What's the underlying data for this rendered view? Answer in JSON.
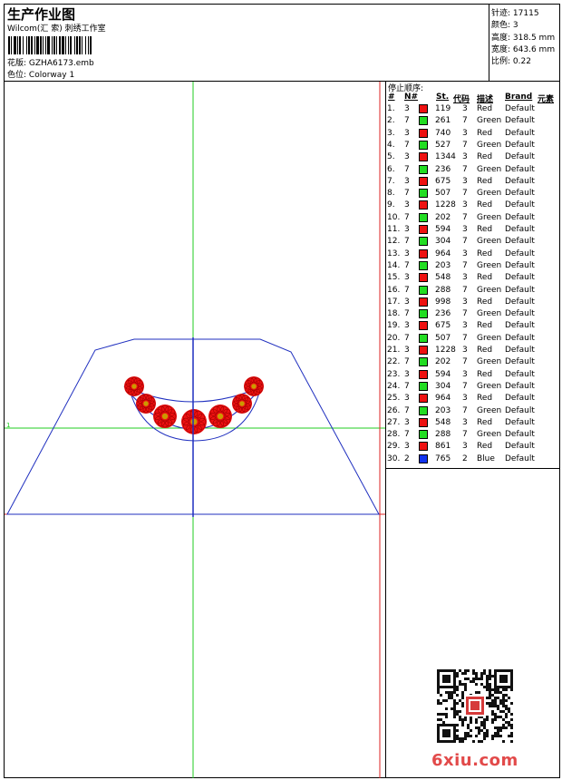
{
  "header": {
    "title": "生产作业图",
    "subtitle": "Wilcom(汇 索) 刺绣工作室",
    "design_label": "花版:",
    "design_value": "GZHA6173.emb",
    "colorway_label": "色位:",
    "colorway_value": "Colorway 1"
  },
  "stats": {
    "stitches_label": "针迹:",
    "stitches_value": "17115",
    "colors_label": "颜色:",
    "colors_value": "3",
    "height_label": "高度:",
    "height_value": "318.5 mm",
    "width_label": "宽度:",
    "width_value": "643.6 mm",
    "scale_label": "比例:",
    "scale_value": "0.22"
  },
  "stop_sequence": {
    "title": "停止顺序:",
    "headers": [
      "#",
      "N#",
      "St.",
      "代码",
      "描述",
      "Brand",
      "元素"
    ],
    "rows": [
      {
        "idx": "1.",
        "n": "3",
        "color": "#ee1111",
        "st": "119",
        "code": "3",
        "desc": "Red",
        "brand": "Default"
      },
      {
        "idx": "2.",
        "n": "7",
        "color": "#22dd22",
        "st": "261",
        "code": "7",
        "desc": "Green",
        "brand": "Default"
      },
      {
        "idx": "3.",
        "n": "3",
        "color": "#ee1111",
        "st": "740",
        "code": "3",
        "desc": "Red",
        "brand": "Default"
      },
      {
        "idx": "4.",
        "n": "7",
        "color": "#22dd22",
        "st": "527",
        "code": "7",
        "desc": "Green",
        "brand": "Default"
      },
      {
        "idx": "5.",
        "n": "3",
        "color": "#ee1111",
        "st": "1344",
        "code": "3",
        "desc": "Red",
        "brand": "Default"
      },
      {
        "idx": "6.",
        "n": "7",
        "color": "#22dd22",
        "st": "236",
        "code": "7",
        "desc": "Green",
        "brand": "Default"
      },
      {
        "idx": "7.",
        "n": "3",
        "color": "#ee1111",
        "st": "675",
        "code": "3",
        "desc": "Red",
        "brand": "Default"
      },
      {
        "idx": "8.",
        "n": "7",
        "color": "#22dd22",
        "st": "507",
        "code": "7",
        "desc": "Green",
        "brand": "Default"
      },
      {
        "idx": "9.",
        "n": "3",
        "color": "#ee1111",
        "st": "1228",
        "code": "3",
        "desc": "Red",
        "brand": "Default"
      },
      {
        "idx": "10.",
        "n": "7",
        "color": "#22dd22",
        "st": "202",
        "code": "7",
        "desc": "Green",
        "brand": "Default"
      },
      {
        "idx": "11.",
        "n": "3",
        "color": "#ee1111",
        "st": "594",
        "code": "3",
        "desc": "Red",
        "brand": "Default"
      },
      {
        "idx": "12.",
        "n": "7",
        "color": "#22dd22",
        "st": "304",
        "code": "7",
        "desc": "Green",
        "brand": "Default"
      },
      {
        "idx": "13.",
        "n": "3",
        "color": "#ee1111",
        "st": "964",
        "code": "3",
        "desc": "Red",
        "brand": "Default"
      },
      {
        "idx": "14.",
        "n": "7",
        "color": "#22dd22",
        "st": "203",
        "code": "7",
        "desc": "Green",
        "brand": "Default"
      },
      {
        "idx": "15.",
        "n": "3",
        "color": "#ee1111",
        "st": "548",
        "code": "3",
        "desc": "Red",
        "brand": "Default"
      },
      {
        "idx": "16.",
        "n": "7",
        "color": "#22dd22",
        "st": "288",
        "code": "7",
        "desc": "Green",
        "brand": "Default"
      },
      {
        "idx": "17.",
        "n": "3",
        "color": "#ee1111",
        "st": "998",
        "code": "3",
        "desc": "Red",
        "brand": "Default"
      },
      {
        "idx": "18.",
        "n": "7",
        "color": "#22dd22",
        "st": "236",
        "code": "7",
        "desc": "Green",
        "brand": "Default"
      },
      {
        "idx": "19.",
        "n": "3",
        "color": "#ee1111",
        "st": "675",
        "code": "3",
        "desc": "Red",
        "brand": "Default"
      },
      {
        "idx": "20.",
        "n": "7",
        "color": "#22dd22",
        "st": "507",
        "code": "7",
        "desc": "Green",
        "brand": "Default"
      },
      {
        "idx": "21.",
        "n": "3",
        "color": "#ee1111",
        "st": "1228",
        "code": "3",
        "desc": "Red",
        "brand": "Default"
      },
      {
        "idx": "22.",
        "n": "7",
        "color": "#22dd22",
        "st": "202",
        "code": "7",
        "desc": "Green",
        "brand": "Default"
      },
      {
        "idx": "23.",
        "n": "3",
        "color": "#ee1111",
        "st": "594",
        "code": "3",
        "desc": "Red",
        "brand": "Default"
      },
      {
        "idx": "24.",
        "n": "7",
        "color": "#22dd22",
        "st": "304",
        "code": "7",
        "desc": "Green",
        "brand": "Default"
      },
      {
        "idx": "25.",
        "n": "3",
        "color": "#ee1111",
        "st": "964",
        "code": "3",
        "desc": "Red",
        "brand": "Default"
      },
      {
        "idx": "26.",
        "n": "7",
        "color": "#22dd22",
        "st": "203",
        "code": "7",
        "desc": "Green",
        "brand": "Default"
      },
      {
        "idx": "27.",
        "n": "3",
        "color": "#ee1111",
        "st": "548",
        "code": "3",
        "desc": "Red",
        "brand": "Default"
      },
      {
        "idx": "28.",
        "n": "7",
        "color": "#22dd22",
        "st": "288",
        "code": "7",
        "desc": "Green",
        "brand": "Default"
      },
      {
        "idx": "29.",
        "n": "3",
        "color": "#ee1111",
        "st": "861",
        "code": "3",
        "desc": "Red",
        "brand": "Default"
      },
      {
        "idx": "30.",
        "n": "2",
        "color": "#1133ee",
        "st": "765",
        "code": "2",
        "desc": "Blue",
        "brand": "Default"
      }
    ]
  },
  "watermark": "6xiu.com",
  "colors": {
    "outline": "#1f2fbf",
    "guide_green": "#22cc22",
    "guide_red": "#dd2222",
    "motif_red": "#ee1111"
  }
}
